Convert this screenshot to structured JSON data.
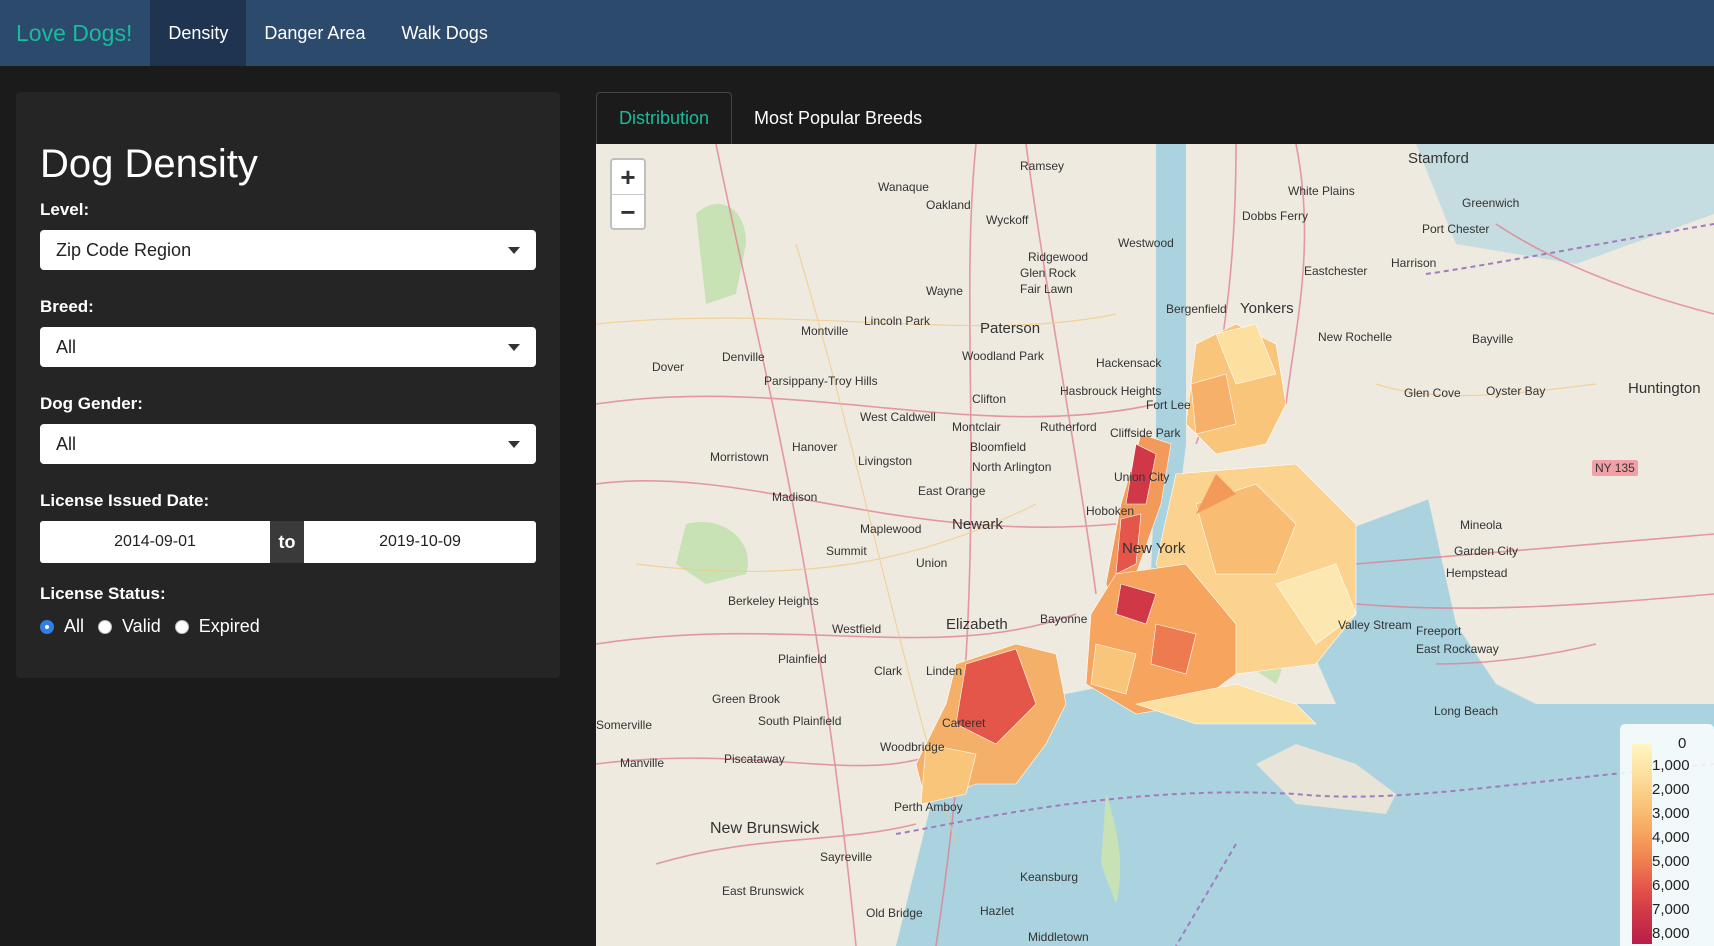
{
  "navbar": {
    "brand": "Love Dogs!",
    "items": [
      {
        "label": "Density",
        "active": true
      },
      {
        "label": "Danger Area",
        "active": false
      },
      {
        "label": "Walk Dogs",
        "active": false
      }
    ]
  },
  "sidebar": {
    "title": "Dog Density",
    "level": {
      "label": "Level:",
      "value": "Zip Code Region"
    },
    "breed": {
      "label": "Breed:",
      "value": "All"
    },
    "gender": {
      "label": "Dog Gender:",
      "value": "All"
    },
    "date": {
      "label": "License Issued Date:",
      "start": "2014-09-01",
      "separator": "to",
      "end": "2019-10-09"
    },
    "status": {
      "label": "License Status:",
      "options": [
        {
          "label": "All",
          "selected": true
        },
        {
          "label": "Valid",
          "selected": false
        },
        {
          "label": "Expired",
          "selected": false
        }
      ]
    }
  },
  "tabs": [
    {
      "label": "Distribution",
      "active": true
    },
    {
      "label": "Most Popular Breeds",
      "active": false
    }
  ],
  "map": {
    "zoom_in": "+",
    "zoom_out": "−",
    "legend": {
      "labels": [
        "0",
        "1,000",
        "2,000",
        "3,000",
        "4,000",
        "5,000",
        "6,000",
        "7,000",
        "8,000"
      ]
    },
    "places": [
      "Stamford",
      "Ramsey",
      "Wanaque",
      "Oakland",
      "Wyckoff",
      "White Plains",
      "Greenwich",
      "Port Chester",
      "Dobbs Ferry",
      "Westwood",
      "Ridgewood",
      "Glen Rock",
      "Fair Lawn",
      "Wayne",
      "Bergenfield",
      "Yonkers",
      "Harrison",
      "Eastchester",
      "Paterson",
      "Lincoln Park",
      "Montville",
      "Woodland Park",
      "Denville",
      "Parsippany-Troy Hills",
      "Dover",
      "New Rochelle",
      "Bayville",
      "Hackensack",
      "Glen Cove",
      "Oyster Bay",
      "Huntington",
      "Hasbrouck Heights",
      "Clifton",
      "West Caldwell",
      "Fort Lee",
      "Montclair",
      "Rutherford",
      "Cliffside Park",
      "Hanover",
      "Morristown",
      "Livingston",
      "Bloomfield",
      "North Arlington",
      "Union City",
      "Madison",
      "East Orange",
      "Hoboken",
      "New York",
      "Newark",
      "Maplewood",
      "Summit",
      "Union",
      "Mineola",
      "Garden City",
      "Hempstead",
      "Berkeley Heights",
      "Westfield",
      "Elizabeth",
      "Bayonne",
      "Valley Stream",
      "Freeport",
      "East Rockaway",
      "Plainfield",
      "Clark",
      "Linden",
      "Green Brook",
      "South Plainfield",
      "Somerville",
      "Carteret",
      "Long Beach",
      "Piscataway",
      "Woodbridge",
      "Manville",
      "Perth Amboy",
      "New Brunswick",
      "Sayreville",
      "East Brunswick",
      "Old Bridge",
      "Keansburg",
      "Hazlet",
      "Middletown",
      "NY 135"
    ]
  }
}
